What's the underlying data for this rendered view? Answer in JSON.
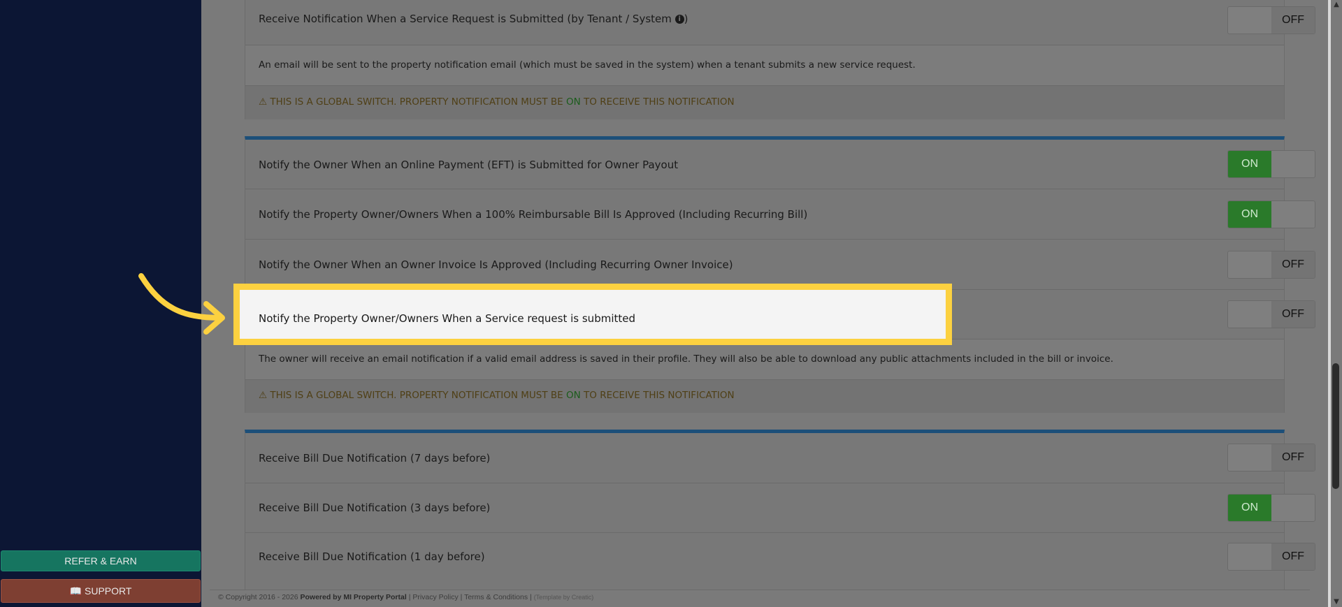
{
  "sidebar": {
    "refer_label": "REFER & EARN",
    "support_label": "SUPPORT"
  },
  "panel1": {
    "title": "Receive Notification When a Service Request is Submitted (by Tenant / System",
    "toggle": "OFF",
    "description": "An email will be sent to the property notification email (which must be saved in the system) when a tenant submits a new service request.",
    "warning_prefix": "THIS IS A GLOBAL SWITCH. PROPERTY NOTIFICATION MUST BE",
    "warning_on": "ON",
    "warning_suffix": "TO RECEIVE THIS NOTIFICATION"
  },
  "panel2": {
    "rows": [
      {
        "title": "Notify the Owner When an Online Payment (EFT) is Submitted for Owner Payout",
        "toggle": "ON"
      },
      {
        "title": "Notify the Property Owner/Owners When a 100% Reimbursable Bill Is Approved (Including Recurring Bill)",
        "toggle": "ON"
      },
      {
        "title": "Notify the Owner When an Owner Invoice Is Approved (Including Recurring Owner Invoice)",
        "toggle": "OFF"
      },
      {
        "title": "Notify the Property Owner/Owners When a Service request is submitted",
        "toggle": "OFF"
      }
    ],
    "description": "The owner will receive an email notification if a valid email address is saved in their profile. They will also be able to download any public attachments included in the bill or invoice.",
    "warning_prefix": "THIS IS A GLOBAL SWITCH. PROPERTY NOTIFICATION MUST BE",
    "warning_on": "ON",
    "warning_suffix": "TO RECEIVE THIS NOTIFICATION"
  },
  "panel3": {
    "rows": [
      {
        "title": "Receive Bill Due Notification (7 days before)",
        "toggle": "OFF"
      },
      {
        "title": "Receive Bill Due Notification (3 days before)",
        "toggle": "ON"
      },
      {
        "title": "Receive Bill Due Notification (1 day before)",
        "toggle": "OFF"
      }
    ]
  },
  "footer": {
    "copyright": "© Copyright 2016 - 2026",
    "powered": "Powered by MI Property Portal",
    "privacy": "Privacy Policy",
    "terms": "Terms & Conditions",
    "template": "(Template by Creatic)"
  },
  "colors": {
    "accent_bar": "#1c4f79",
    "toggle_on": "#2a7a2a",
    "highlight": "#fcd140",
    "sidebar_bg": "#0c1634"
  },
  "icons": {
    "info": "info-circle-icon",
    "warning": "warning-triangle-icon",
    "support": "book-icon",
    "callout": "curved-arrow-icon"
  }
}
